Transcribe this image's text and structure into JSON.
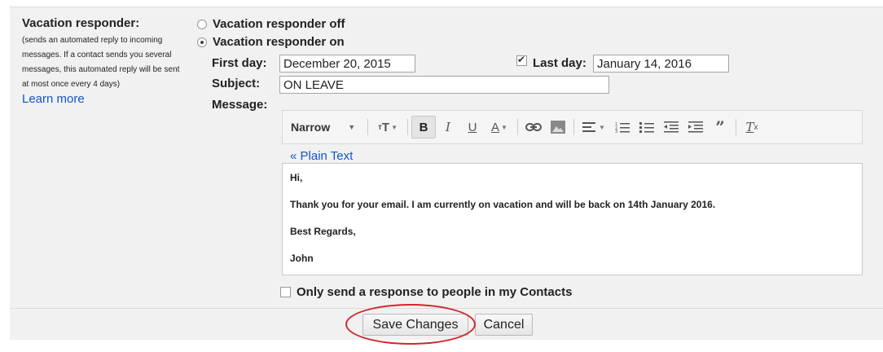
{
  "left": {
    "title": "Vacation responder:",
    "description": "(sends an automated reply to incoming messages. If a contact sends you several messages, this automated reply will be sent at most once every 4 days)",
    "learn_more": "Learn more"
  },
  "radios": {
    "off_label": "Vacation responder off",
    "on_label": "Vacation responder on",
    "selected": "on"
  },
  "fields": {
    "first_day_label": "First day:",
    "first_day_value": "December 20, 2015",
    "last_day_label": "Last day:",
    "last_day_checked": true,
    "last_day_value": "January 14, 2016",
    "subject_label": "Subject:",
    "subject_value": "ON LEAVE",
    "message_label": "Message:"
  },
  "toolbar": {
    "font_name": "Narrow",
    "icons": [
      "font-size-icon",
      "bold-icon",
      "italic-icon",
      "underline-icon",
      "text-color-icon",
      "link-icon",
      "image-icon",
      "align-icon",
      "numbered-list-icon",
      "bulleted-list-icon",
      "indent-less-icon",
      "indent-more-icon",
      "quote-icon",
      "remove-formatting-icon"
    ],
    "bold_active": true
  },
  "editor": {
    "plain_text_link": "« Plain Text",
    "lines": [
      "Hi,",
      "Thank you  for your email. I am currently on vacation and will be back on 14th January 2016.",
      "Best Regards,",
      "John"
    ]
  },
  "contacts_only": {
    "label": "Only send a response to people in my Contacts",
    "checked": false
  },
  "actions": {
    "save": "Save Changes",
    "cancel": "Cancel"
  },
  "colors": {
    "link": "#1155cc",
    "highlight": "#d0262c"
  }
}
